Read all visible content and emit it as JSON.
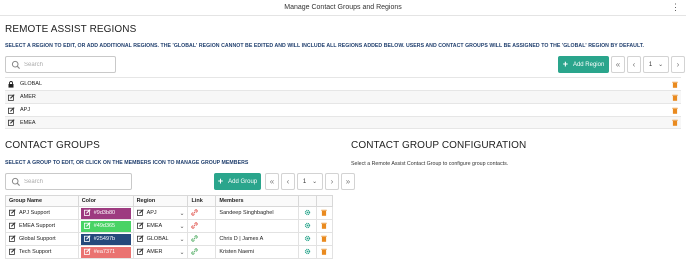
{
  "window": {
    "title": "Manage Contact Groups and Regions"
  },
  "regions": {
    "heading": "REMOTE ASSIST REGIONS",
    "instructions": "SELECT A REGION TO EDIT, OR ADD ADDITIONAL REGIONS. THE 'GLOBAL' REGION CANNOT BE EDITED AND WILL INCLUDE ALL REGIONS ADDED BELOW. USERS AND CONTACT GROUPS WILL BE ASSIGNED TO THE 'GLOBAL' REGION BY DEFAULT.",
    "search_placeholder": "Search",
    "add_label": "Add Region",
    "page": "1",
    "items": [
      {
        "label": "GLOBAL",
        "icon": "lock-icon"
      },
      {
        "label": "AMER",
        "icon": "edit-icon"
      },
      {
        "label": "APJ",
        "icon": "edit-icon"
      },
      {
        "label": "EMEA",
        "icon": "edit-icon"
      }
    ]
  },
  "groups": {
    "heading": "CONTACT GROUPS",
    "instructions": "SELECT A GROUP TO EDIT, OR CLICK ON THE MEMBERS ICON TO MANAGE GROUP MEMBERS",
    "search_placeholder": "Search",
    "add_label": "Add Group",
    "page": "1",
    "columns": [
      "Group Name",
      "Color",
      "Region",
      "Link",
      "Members"
    ],
    "rows": [
      {
        "name": "APJ Support",
        "color_label": "#9d3b80",
        "color": "#9d3b80",
        "region": "APJ",
        "link_color": "#e0524b",
        "members": "Sandeep Singhbaghel"
      },
      {
        "name": "EMEA Support",
        "color_label": "#49d365",
        "color": "#49d365",
        "region": "EMEA",
        "link_color": "#e0524b",
        "members": ""
      },
      {
        "name": "Global Support",
        "color_label": "#25497b",
        "color": "#25497b",
        "region": "GLOBAL",
        "link_color": "#4caa5f",
        "members": "Chris D | James A"
      },
      {
        "name": "Tech Support",
        "color_label": "#ea7371",
        "color": "#ea7371",
        "region": "AMER",
        "link_color": "#4caa5f",
        "members": "Kristen Naemi"
      }
    ]
  },
  "config": {
    "heading": "CONTACT GROUP CONFIGURATION",
    "message": "Select a Remote Assist Contact Group to configure group contacts."
  },
  "colors": {
    "accent": "#2aa58c",
    "heading_blue": "#1f3e6d",
    "delete_orange": "#e98a1f",
    "gear_green": "#2aa58c"
  }
}
